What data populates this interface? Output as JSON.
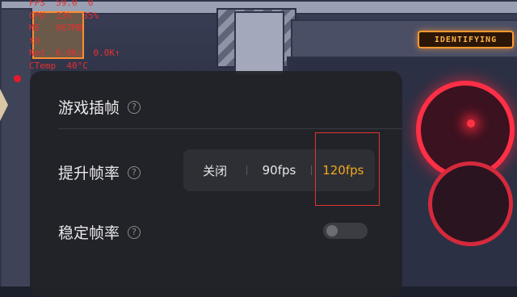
{
  "background": {
    "sign_text": "IDENTIFYING"
  },
  "overlay": {
    "lines": [
      "FPS  59.0  0",
      "CPU  13%  35%",
      "ME   867MB",
      "t0",
      "Net  0.0K↓  0.0K↑",
      "CTemp  40°C"
    ]
  },
  "panel": {
    "title": "游戏插帧",
    "help_glyph": "?",
    "fps_row": {
      "label": "提升帧率",
      "options": [
        "关闭",
        "90fps",
        "120fps"
      ],
      "selected": "120fps"
    },
    "stable_row": {
      "label": "稳定帧率",
      "toggle_on": false
    }
  },
  "colors": {
    "accent": "#f2a81d",
    "highlight_box": "#e2332d",
    "overlay_text": "#e53030",
    "panel_bg": "#222328"
  }
}
